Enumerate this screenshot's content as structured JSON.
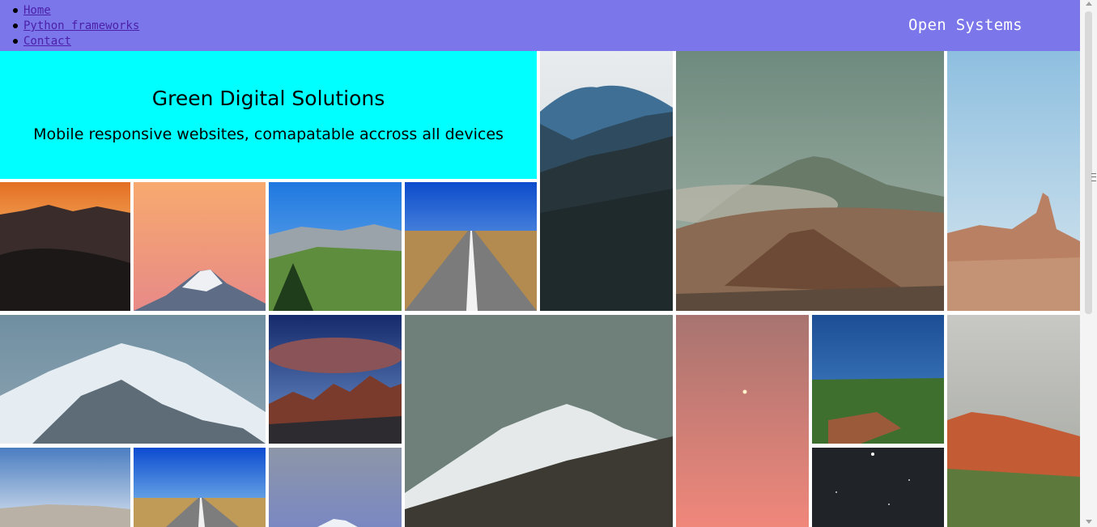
{
  "nav": {
    "items": [
      {
        "label": "Home"
      },
      {
        "label": "Python frameworks"
      },
      {
        "label": "Contact"
      }
    ]
  },
  "brand": "Open Systems",
  "hero": {
    "title": "Green Digital Solutions",
    "subtitle": "Mobile responsive websites, comapatable accross all devices"
  },
  "colors": {
    "header_bg": "#7b77ea",
    "hero_bg": "#00ffff",
    "link": "#4b1fa8"
  },
  "gallery": [
    "dark-forest-mountains-photo",
    "volcano-crater-photo",
    "desert-rock-spire-photo",
    "orange-sunset-ridges-photo",
    "pink-sky-snowy-peak-photo",
    "green-mountain-valley-photo",
    "desert-road-photo",
    "snowy-mountain-range-photo",
    "red-clouds-peaks-photo",
    "misty-snow-summit-photo",
    "pink-starry-sky-photo",
    "green-plateau-photo",
    "red-rock-outcrop-photo",
    "cloudy-sky-badlands-photo",
    "desert-road-blue-sky-photo",
    "purple-dusk-peak-photo",
    "night-stars-photo"
  ]
}
